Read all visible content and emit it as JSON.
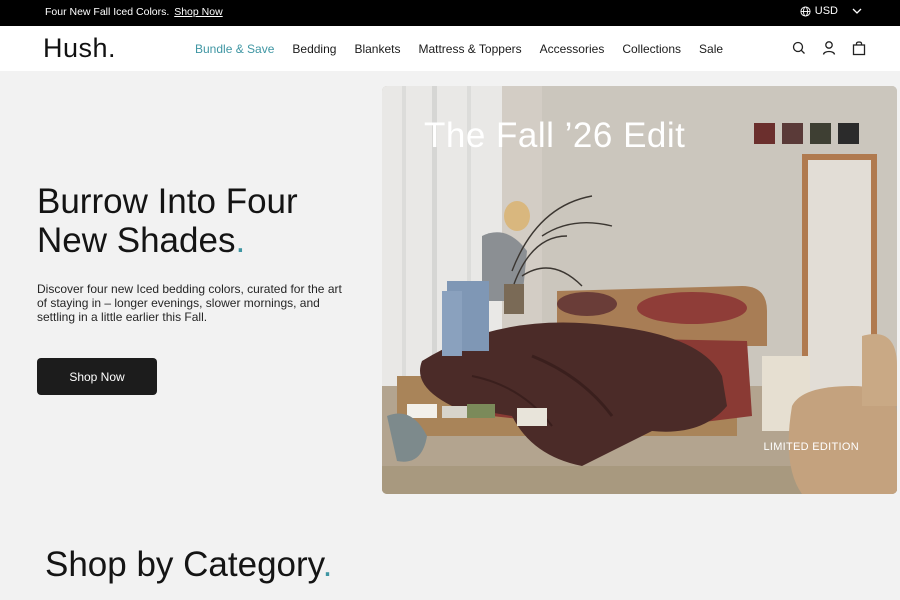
{
  "announcement": {
    "text": "Four New Fall Iced Colors.",
    "link": "Shop Now",
    "currency": "USD"
  },
  "header": {
    "logo": "Hush",
    "logo_dot": ".",
    "nav": [
      {
        "label": "Bundle & Save",
        "active": true
      },
      {
        "label": "Bedding",
        "active": false
      },
      {
        "label": "Blankets",
        "active": false
      },
      {
        "label": "Mattress & Toppers",
        "active": false
      },
      {
        "label": "Accessories",
        "active": false
      },
      {
        "label": "Collections",
        "active": false
      },
      {
        "label": "Sale",
        "active": false
      }
    ],
    "icons": [
      "search-icon",
      "account-icon",
      "bag-icon"
    ]
  },
  "hero": {
    "title_line1": "Burrow Into Four",
    "title_line2": "New Shades",
    "title_dot": ".",
    "description": "Discover four new Iced bedding colors, curated for the art of staying in – longer evenings, slower mornings, and settling in a little earlier this Fall.",
    "cta": "Shop Now",
    "image": {
      "edit_title": "The Fall ’26 Edit",
      "badge": "LIMITED EDITION",
      "swatches": [
        "#6b2f2d",
        "#5a3a38",
        "#3e3f33",
        "#2b2b2b"
      ]
    }
  },
  "category": {
    "title": "Shop by Category",
    "dot": "."
  },
  "colors": {
    "accent": "#3f96a3",
    "announcement_bg": "#000000",
    "button_bg": "#1c1c1c",
    "page_bg": "#f2f2f2"
  }
}
